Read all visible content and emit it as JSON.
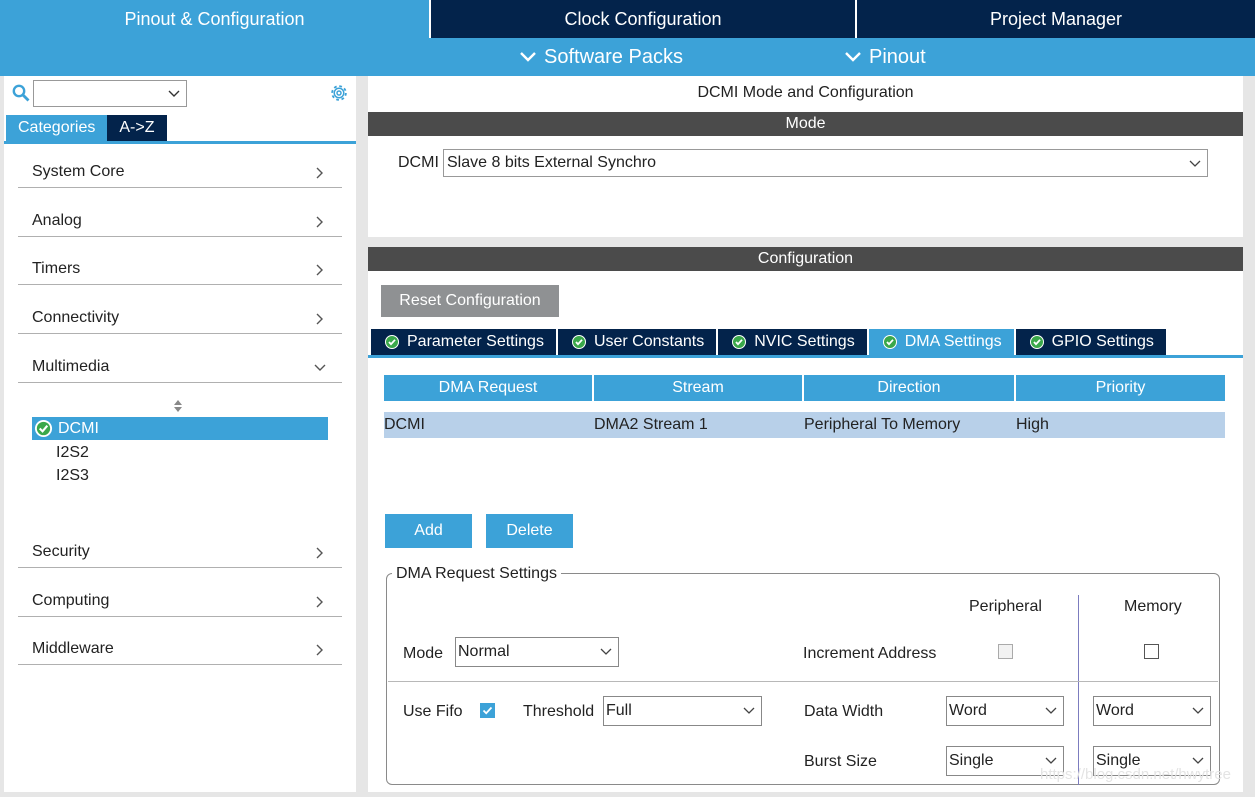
{
  "top_tabs": {
    "pinout": "Pinout & Configuration",
    "clock": "Clock Configuration",
    "project": "Project Manager"
  },
  "sub_bar": {
    "software_packs": "Software Packs",
    "pinout": "Pinout"
  },
  "sidebar": {
    "search_value": "",
    "tabs": {
      "categories": "Categories",
      "az": "A->Z"
    },
    "categories": [
      {
        "label": "System Core"
      },
      {
        "label": "Analog"
      },
      {
        "label": "Timers"
      },
      {
        "label": "Connectivity"
      },
      {
        "label": "Multimedia"
      },
      {
        "label": "Security"
      },
      {
        "label": "Computing"
      },
      {
        "label": "Middleware"
      }
    ],
    "multimedia_items": [
      {
        "label": "DCMI"
      },
      {
        "label": "I2S2"
      },
      {
        "label": "I2S3"
      }
    ]
  },
  "mode_panel": {
    "title": "DCMI Mode and Configuration",
    "mode_header": "Mode",
    "dcmi_label": "DCMI",
    "dcmi_value": "Slave 8 bits External Synchro"
  },
  "config_panel": {
    "header": "Configuration",
    "reset_label": "Reset Configuration",
    "tabs": [
      {
        "label": "Parameter Settings"
      },
      {
        "label": "User Constants"
      },
      {
        "label": "NVIC Settings"
      },
      {
        "label": "DMA Settings"
      },
      {
        "label": "GPIO Settings"
      }
    ],
    "dma_table": {
      "columns": [
        "DMA Request",
        "Stream",
        "Direction",
        "Priority"
      ],
      "rows": [
        [
          "DCMI",
          "DMA2 Stream 1",
          "Peripheral To Memory",
          "High"
        ]
      ]
    },
    "add_label": "Add",
    "delete_label": "Delete",
    "request_settings": {
      "legend": "DMA Request Settings",
      "peripheral_header": "Peripheral",
      "memory_header": "Memory",
      "mode_label": "Mode",
      "mode_value": "Normal",
      "increment_label": "Increment Address",
      "use_fifo_label": "Use Fifo",
      "threshold_label": "Threshold",
      "threshold_value": "Full",
      "data_width_label": "Data Width",
      "periph_data_width": "Word",
      "mem_data_width": "Word",
      "burst_size_label": "Burst Size",
      "periph_burst": "Single",
      "mem_burst": "Single"
    }
  },
  "watermark": "https://blog.csdn.net/hwytree",
  "colors": {
    "accent": "#3ca2d8",
    "navy": "#03234b",
    "header_gray": "#4b4b4b",
    "row_select": "#b8d0e9"
  }
}
